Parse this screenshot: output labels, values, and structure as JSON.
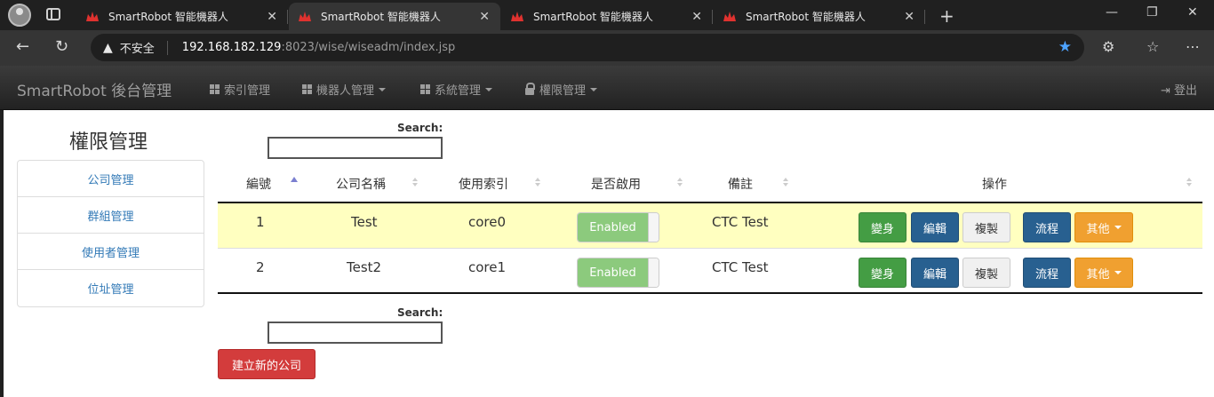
{
  "browser": {
    "tabs": [
      {
        "title": "SmartRobot 智能機器人"
      },
      {
        "title": "SmartRobot 智能機器人"
      },
      {
        "title": "SmartRobot 智能機器人"
      },
      {
        "title": "SmartRobot 智能機器人"
      }
    ],
    "address": {
      "insecure_label": "不安全",
      "host": "192.168.182.129",
      "path": ":8023/wise/wiseadm/index.jsp"
    }
  },
  "navbar": {
    "brand": "SmartRobot 後台管理",
    "items": [
      {
        "label": "索引管理",
        "icon": "grid-icon",
        "dropdown": false
      },
      {
        "label": "機器人管理",
        "icon": "grid-icon",
        "dropdown": true
      },
      {
        "label": "系統管理",
        "icon": "grid-icon",
        "dropdown": true
      },
      {
        "label": "權限管理",
        "icon": "lock-icon",
        "dropdown": true
      }
    ],
    "logout": "登出"
  },
  "sidebar": {
    "title": "權限管理",
    "items": [
      {
        "label": "公司管理"
      },
      {
        "label": "群組管理"
      },
      {
        "label": "使用者管理"
      },
      {
        "label": "位址管理"
      }
    ]
  },
  "search": {
    "label": "Search:",
    "value": ""
  },
  "table": {
    "headers": [
      "編號",
      "公司名稱",
      "使用索引",
      "是否啟用",
      "備註",
      "操作"
    ],
    "rows": [
      {
        "id": "1",
        "name": "Test",
        "index": "core0",
        "enabled": "Enabled",
        "note": "CTC Test"
      },
      {
        "id": "2",
        "name": "Test2",
        "index": "core1",
        "enabled": "Enabled",
        "note": "CTC Test"
      }
    ],
    "actions": {
      "transform": "變身",
      "edit": "編輯",
      "copy": "複製",
      "flow": "流程",
      "other": "其他"
    }
  },
  "create_button": "建立新的公司",
  "colors": {
    "highlight_row": "#ffffc0",
    "enabled_toggle": "#8cca7d",
    "create_button": "#d33c3c"
  }
}
